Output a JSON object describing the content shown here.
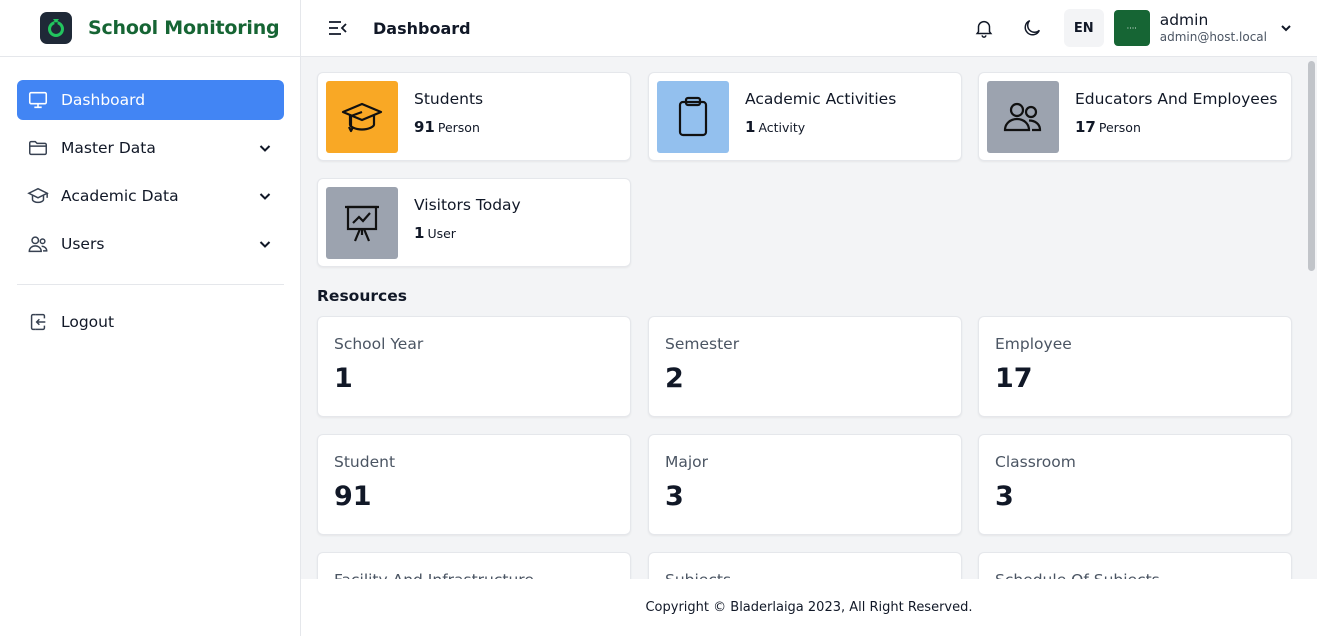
{
  "brand": {
    "title": "School Monitoring",
    "logo_color": "#166534"
  },
  "sidebar": {
    "items": [
      {
        "label": "Dashboard",
        "icon": "monitor-icon",
        "active": true
      },
      {
        "label": "Master Data",
        "icon": "folder-icon",
        "expandable": true
      },
      {
        "label": "Academic Data",
        "icon": "graduation-cap-icon",
        "expandable": true
      },
      {
        "label": "Users",
        "icon": "users-icon",
        "expandable": true
      }
    ],
    "logout_label": "Logout",
    "active_color": "#4285f4"
  },
  "header": {
    "title": "Dashboard",
    "language": "EN",
    "user_name": "admin",
    "user_email": "admin@host.local",
    "avatar_text": "····"
  },
  "stats": [
    {
      "title": "Students",
      "value": "91",
      "unit": "Person",
      "color": "#f9a825",
      "icon": "graduation-cap-icon"
    },
    {
      "title": "Academic Activities",
      "value": "1",
      "unit": "Activity",
      "color": "#93c0ee",
      "icon": "clipboard-icon"
    },
    {
      "title": "Educators And Employees",
      "value": "17",
      "unit": "Person",
      "color": "#9ca3af",
      "icon": "users-icon"
    },
    {
      "title": "Visitors Today",
      "value": "1",
      "unit": "User",
      "color": "#9ca3af",
      "icon": "presentation-chart-icon"
    }
  ],
  "resources": {
    "heading": "Resources",
    "items": [
      {
        "label": "School Year",
        "value": "1"
      },
      {
        "label": "Semester",
        "value": "2"
      },
      {
        "label": "Employee",
        "value": "17"
      },
      {
        "label": "Student",
        "value": "91"
      },
      {
        "label": "Major",
        "value": "3"
      },
      {
        "label": "Classroom",
        "value": "3"
      },
      {
        "label": "Facility And Infrastructure",
        "value": ""
      },
      {
        "label": "Subjects",
        "value": ""
      },
      {
        "label": "Schedule Of Subjects",
        "value": ""
      }
    ]
  },
  "footer": {
    "text": "Copyright © Bladerlaiga 2023, All Right Reserved."
  }
}
